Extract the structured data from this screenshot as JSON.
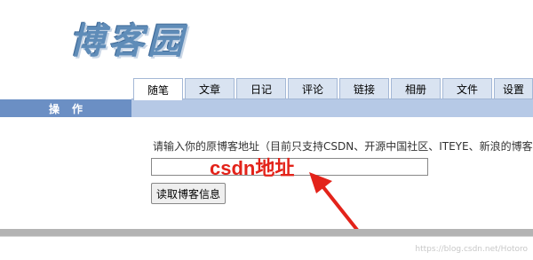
{
  "logo": {
    "text": "博客园"
  },
  "sidebar": {
    "header": "操作"
  },
  "tabs": [
    {
      "label": "随笔",
      "active": true
    },
    {
      "label": "文章",
      "active": false
    },
    {
      "label": "日记",
      "active": false
    },
    {
      "label": "评论",
      "active": false
    },
    {
      "label": "链接",
      "active": false
    },
    {
      "label": "相册",
      "active": false
    },
    {
      "label": "文件",
      "active": false
    },
    {
      "label": "设置",
      "active": false
    }
  ],
  "main": {
    "prompt": "请输入你的原博客地址（目前只支持CSDN、开源中国社区、ITEYE、新浪的博客",
    "url_value": "",
    "read_button": "读取博客信息"
  },
  "annotation": {
    "text": "csdn地址",
    "color": "#e3231a"
  },
  "watermark": "https://blog.csdn.net/Hotoro",
  "colors": {
    "sidebar_header": "#6b8fc4",
    "tab_bg": "#d9e3f1",
    "strip": "#b6c9e6"
  }
}
